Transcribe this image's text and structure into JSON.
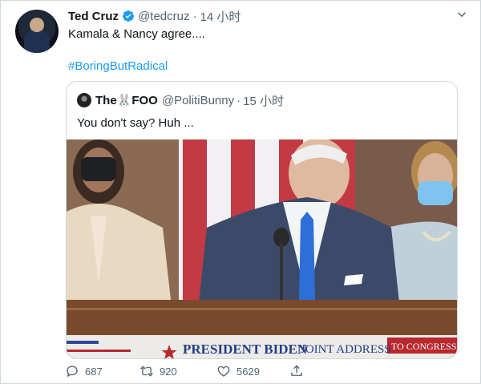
{
  "tweet": {
    "author_name": "Ted Cruz",
    "author_handle": "@tedcruz",
    "separator": "·",
    "time": "14 小时",
    "text": "Kamala & Nancy agree....",
    "hashtag": "#BoringButRadical"
  },
  "quoted": {
    "author_name": "The🐰FOO",
    "author_handle": "@PolitiBunny",
    "separator": "·",
    "time": "15 小时",
    "text": "You don't say? Huh ...",
    "media": {
      "chyron_main": "PRESIDENT BIDEN",
      "chyron_sub": "JOINT ADDRESS",
      "chyron_tag": "TO CONGRESS"
    }
  },
  "actions": {
    "replies": "687",
    "retweets": "920",
    "likes": "5629"
  },
  "colors": {
    "link": "#1d9bf0",
    "secondary_text": "#536471",
    "border": "#cfd9de"
  },
  "icons": [
    "verified-icon",
    "more-caret-icon",
    "reply-icon",
    "retweet-icon",
    "like-icon",
    "share-icon"
  ]
}
